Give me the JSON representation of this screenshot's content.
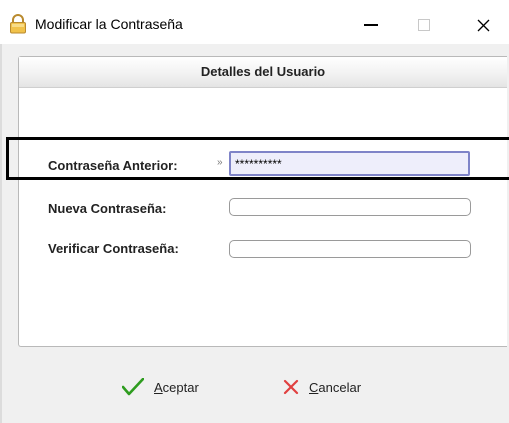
{
  "window": {
    "title": "Modificar la Contraseña",
    "icon": "lock-icon"
  },
  "panel": {
    "header": "Detalles del Usuario"
  },
  "form": {
    "old_password": {
      "label": "Contraseña Anterior:",
      "value": "**********",
      "marker": "»"
    },
    "new_password": {
      "label": "Nueva Contraseña:",
      "value": ""
    },
    "verify_password": {
      "label": "Verificar Contraseña:",
      "value": ""
    }
  },
  "buttons": {
    "accept": {
      "label_first": "A",
      "label_rest": "ceptar",
      "icon": "checkmark-icon"
    },
    "cancel": {
      "label_first": "C",
      "label_rest": "ancelar",
      "icon": "x-icon"
    }
  },
  "colors": {
    "accept_icon": "#2e9c1f",
    "cancel_icon": "#e04040",
    "focused_field_border": "#7f84c8",
    "focused_field_bg": "#eeeefb"
  }
}
